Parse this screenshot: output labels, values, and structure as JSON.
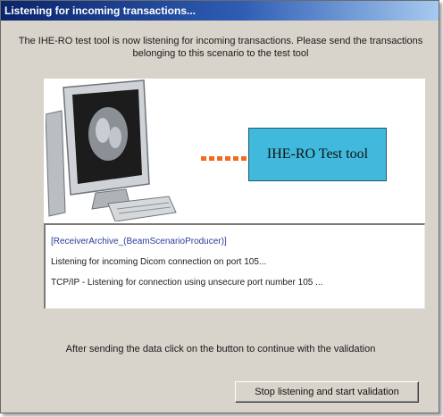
{
  "window": {
    "title": "Listening for incoming transactions..."
  },
  "intro": {
    "text": "The IHE-RO test tool is now listening for incoming transactions. Please send the transactions belonging to this scenario to the test tool"
  },
  "illustration": {
    "tool_label": "IHE-RO Test tool",
    "arrow_color": "#f26b1d",
    "tool_box_color": "#40b9dc"
  },
  "log": {
    "lines": [
      "[ReceiverArchive_(BeamScenarioProducer)]",
      "Listening for incoming Dicom connection on port 105...",
      "TCP/IP - Listening for connection using unsecure port number 105 ..."
    ]
  },
  "footer": {
    "instruction": "After sending the data click on the button to continue with the validation",
    "button_label": "Stop listening and start validation"
  }
}
